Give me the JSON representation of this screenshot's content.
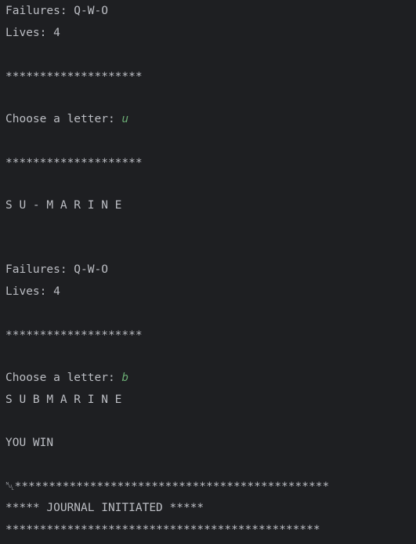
{
  "console": {
    "round1": {
      "failures": "Failures: Q-W-O",
      "lives": "Lives: 4",
      "separator1": "********************",
      "prompt": "Choose a letter: ",
      "input": "u",
      "separator2": "********************",
      "word": "S U - M A R I N E"
    },
    "round2": {
      "failures": "Failures: Q-W-O",
      "lives": "Lives: 4",
      "separator1": "********************",
      "prompt": "Choose a letter: ",
      "input": "b",
      "word": "S U B M A R I N E"
    },
    "result": "YOU WIN",
    "journal": {
      "border_top": "␀**********************************************",
      "title": "***** JOURNAL INITIATED *****",
      "border_bottom": "**********************************************"
    }
  }
}
